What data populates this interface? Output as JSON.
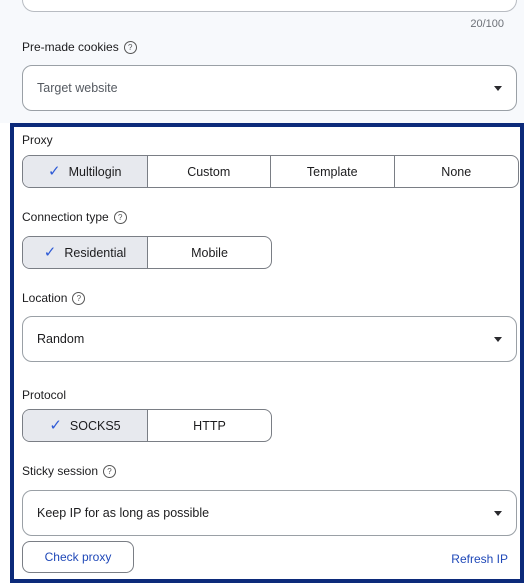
{
  "top": {
    "char_count": "20/100",
    "premade_label": "Pre-made cookies",
    "premade_placeholder": "Target website"
  },
  "proxy": {
    "label": "Proxy",
    "options": [
      "Multilogin",
      "Custom",
      "Template",
      "None"
    ],
    "selected": "Multilogin"
  },
  "connection": {
    "label": "Connection type",
    "options": [
      "Residential",
      "Mobile"
    ],
    "selected": "Residential"
  },
  "location": {
    "label": "Location",
    "value": "Random"
  },
  "protocol": {
    "label": "Protocol",
    "options": [
      "SOCKS5",
      "HTTP"
    ],
    "selected": "SOCKS5"
  },
  "sticky": {
    "label": "Sticky session",
    "value": "Keep IP for as long as possible"
  },
  "actions": {
    "check_proxy": "Check proxy",
    "refresh_ip": "Refresh IP"
  },
  "icons": {
    "help": "?",
    "check": "✓"
  },
  "colors": {
    "accent": "#1f48b8",
    "frame": "#0c2a7a",
    "selected_bg": "#e7e9ee"
  }
}
